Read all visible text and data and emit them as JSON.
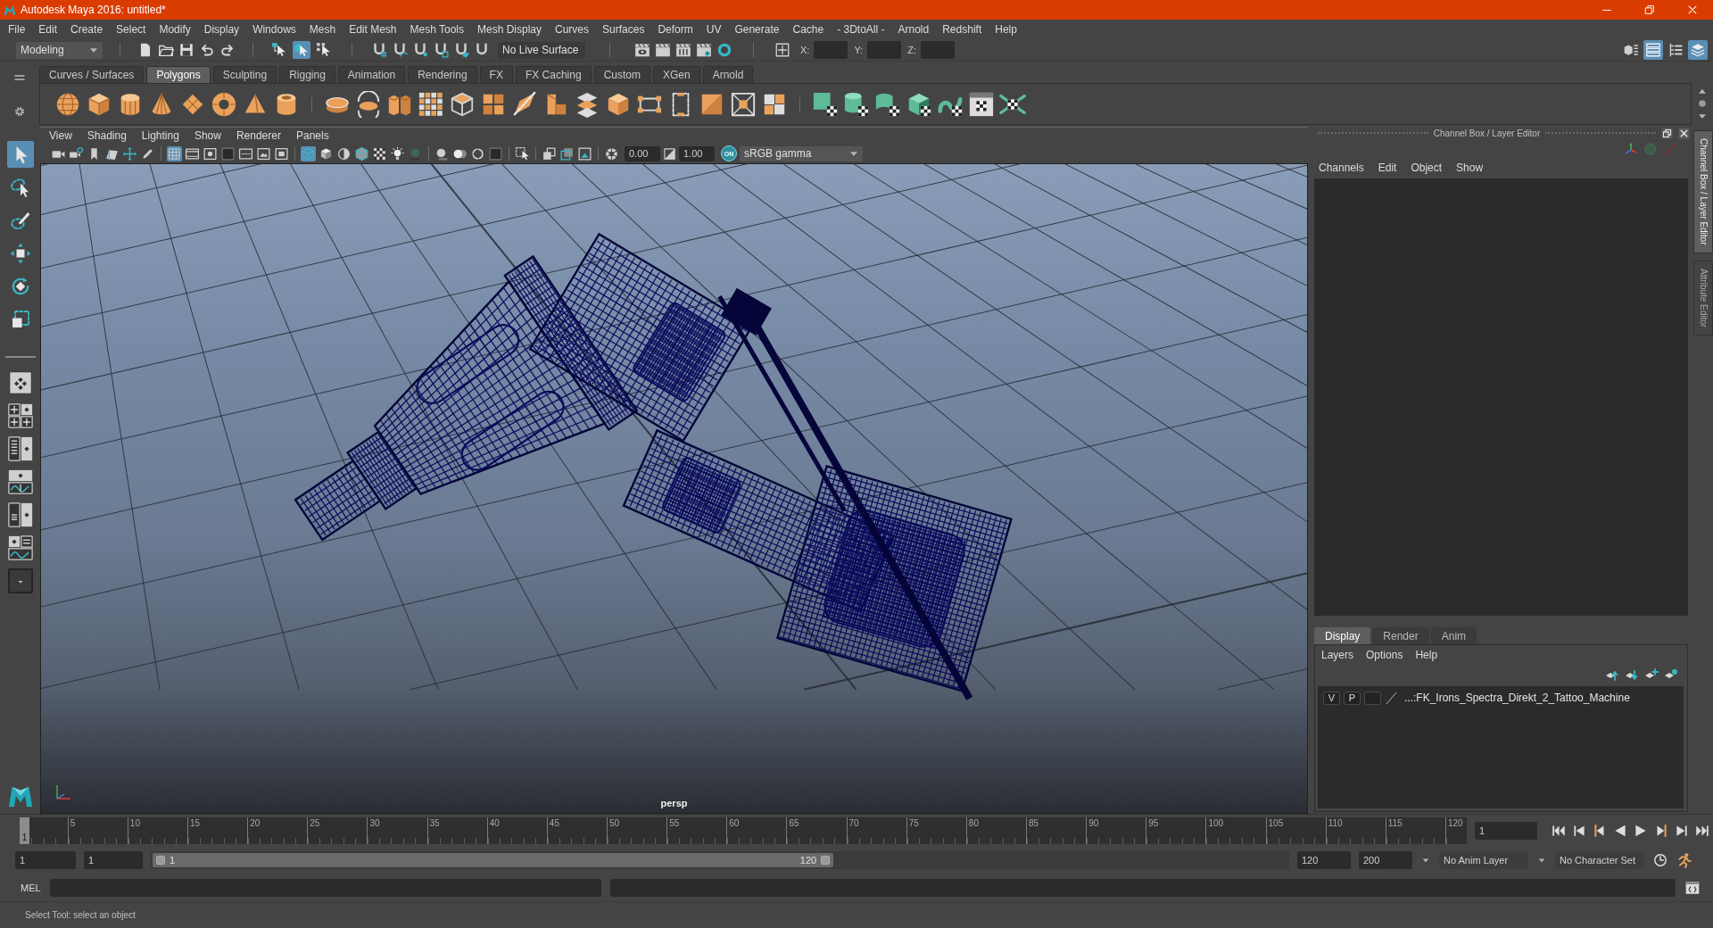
{
  "window": {
    "title": "Autodesk Maya 2016: untitled*"
  },
  "menu_bar": [
    "File",
    "Edit",
    "Create",
    "Select",
    "Modify",
    "Display",
    "Windows",
    "Mesh",
    "Edit Mesh",
    "Mesh Tools",
    "Mesh Display",
    "Curves",
    "Surfaces",
    "Deform",
    "UV",
    "Generate",
    "Cache",
    "- 3DtoAll -",
    "Arnold",
    "Redshift",
    "Help"
  ],
  "status_line": {
    "mode": "Modeling",
    "selection_masks": [
      {
        "on": false
      },
      {
        "on": true
      },
      {
        "on": false
      }
    ],
    "live_surface": "No Live Surface",
    "coordinate_labels": [
      "X:",
      "Y:",
      "Z:"
    ],
    "panel_toggles": [
      {
        "on": false
      },
      {
        "on": true
      },
      {
        "on": false
      },
      {
        "on": true
      }
    ]
  },
  "shelf": {
    "tabs": [
      {
        "label": "Curves / Surfaces",
        "selected": false
      },
      {
        "label": "Polygons",
        "selected": true
      },
      {
        "label": "Sculpting",
        "selected": false
      },
      {
        "label": "Rigging",
        "selected": false
      },
      {
        "label": "Animation",
        "selected": false
      },
      {
        "label": "Rendering",
        "selected": false
      },
      {
        "label": "FX",
        "selected": false
      },
      {
        "label": "FX Caching",
        "selected": false
      },
      {
        "label": "Custom",
        "selected": false
      },
      {
        "label": "XGen",
        "selected": false
      },
      {
        "label": "Arnold",
        "selected": false
      }
    ]
  },
  "toolbox": {
    "tools": [
      {
        "selected": true
      },
      {
        "selected": false
      },
      {
        "selected": false
      },
      {
        "selected": false
      },
      {
        "selected": false
      },
      {
        "selected": false
      }
    ]
  },
  "viewport": {
    "menu": [
      "View",
      "Shading",
      "Lighting",
      "Show",
      "Renderer",
      "Panels"
    ],
    "toggles": [
      {
        "on": true
      },
      {
        "on": true
      },
      {
        "on": false
      }
    ],
    "exposure": "0.00",
    "gamma": "1.00",
    "color_management": {
      "label": "ON",
      "on": true
    },
    "color_space": "sRGB gamma",
    "camera": "persp"
  },
  "channel_box": {
    "title": "Channel Box / Layer Editor",
    "menu": [
      "Channels",
      "Edit",
      "Object",
      "Show"
    ]
  },
  "layer_editor": {
    "tabs": [
      {
        "label": "Display",
        "selected": true
      },
      {
        "label": "Render",
        "selected": false
      },
      {
        "label": "Anim",
        "selected": false
      }
    ],
    "menu": [
      "Layers",
      "Options",
      "Help"
    ],
    "layers": [
      {
        "visibility": "V",
        "playback": "P",
        "name": "...:FK_Irons_Spectra_Direkt_2_Tattoo_Machine"
      }
    ]
  },
  "side_tabs": [
    {
      "label": "Channel Box / Layer Editor",
      "selected": true
    },
    {
      "label": "Attribute Editor",
      "selected": false
    }
  ],
  "timeline": {
    "current_frame": "1",
    "level": 0,
    "ticks": [
      "5",
      "10",
      "15",
      "20",
      "25",
      "30",
      "35",
      "40",
      "45",
      "50",
      "55",
      "60",
      "65",
      "70",
      "75",
      "80",
      "85",
      "90",
      "95",
      "100",
      "105",
      "110",
      "115",
      "120"
    ],
    "frame_field": "1"
  },
  "range": {
    "start_field": "1",
    "range_start_field": "1",
    "slider": {
      "start": "1",
      "end": "120",
      "level": 0.6
    },
    "range_end_field": "120",
    "end_field": "200",
    "anim_layer": "No Anim Layer",
    "character_set": "No Character Set"
  },
  "command_line": {
    "label": "MEL"
  },
  "help_line": "Select Tool: select an object"
}
